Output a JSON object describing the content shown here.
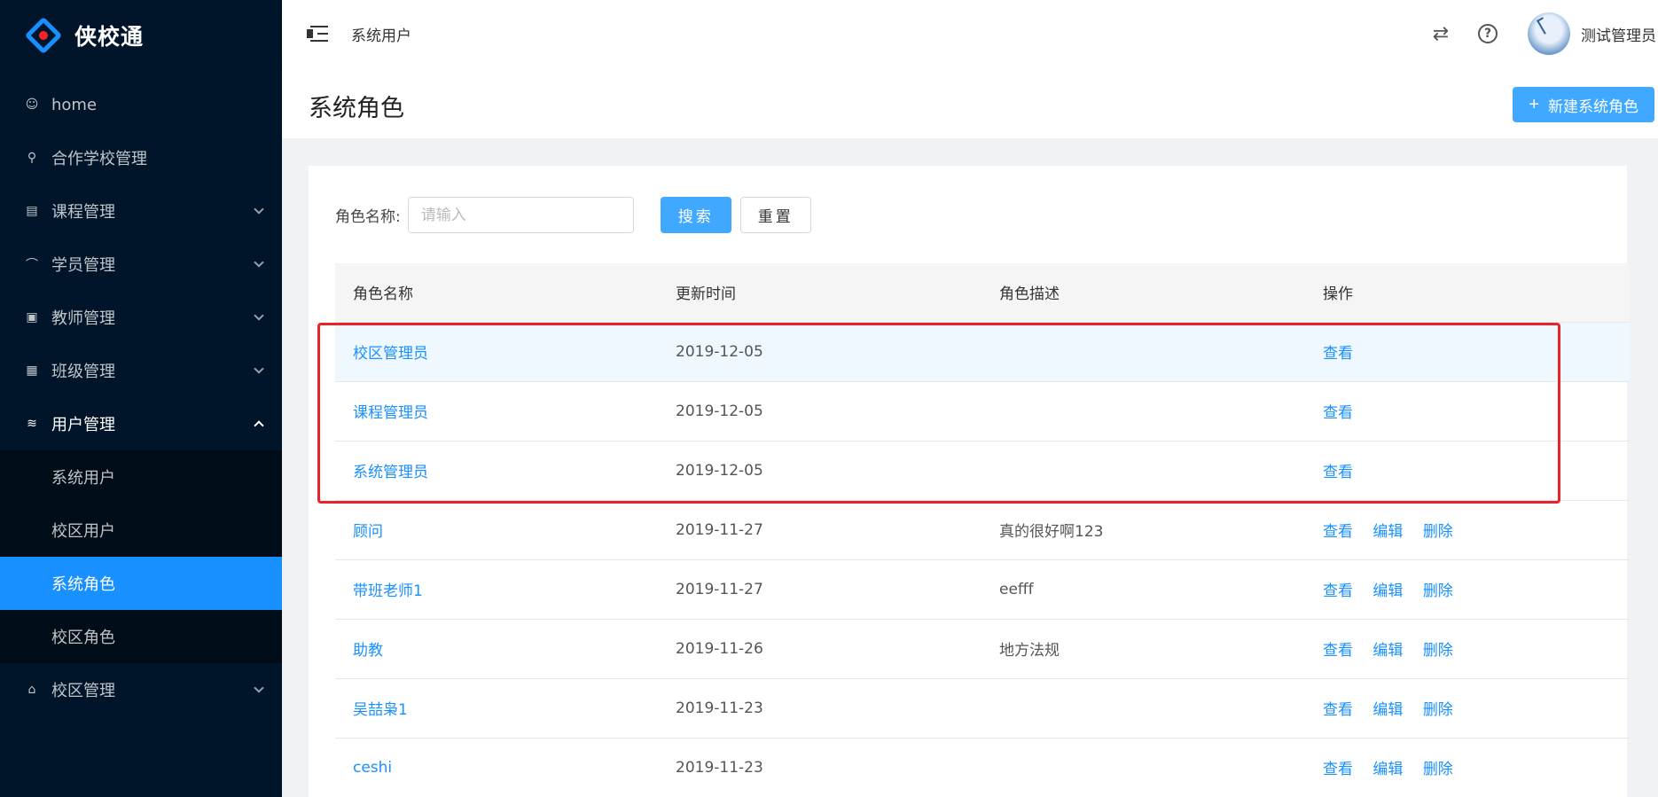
{
  "app": {
    "name": "侠校通"
  },
  "sidebar": {
    "items": [
      {
        "label": "home",
        "icon": "smile-icon"
      },
      {
        "label": "合作学校管理",
        "icon": "bicycle-icon"
      },
      {
        "label": "课程管理",
        "icon": "book-icon"
      },
      {
        "label": "学员管理",
        "icon": "rainbow-icon"
      },
      {
        "label": "教师管理",
        "icon": "idcard-icon"
      },
      {
        "label": "班级管理",
        "icon": "calendar-icon"
      },
      {
        "label": "用户管理",
        "icon": "stack-icon"
      },
      {
        "label": "校区管理",
        "icon": "bank-icon"
      }
    ],
    "submenu": [
      "系统用户",
      "校区用户",
      "系统角色",
      "校区角色"
    ]
  },
  "header": {
    "breadcrumb": "系统用户",
    "username": "测试管理员"
  },
  "page": {
    "title": "系统角色",
    "new_button": "新建系统角色"
  },
  "search": {
    "label": "角色名称:",
    "placeholder": "请输入",
    "search_button": "搜索",
    "reset_button": "重置"
  },
  "table": {
    "columns": [
      "角色名称",
      "更新时间",
      "角色描述",
      "操作"
    ],
    "actions": {
      "view": "查看",
      "edit": "编辑",
      "delete": "删除"
    },
    "rows": [
      {
        "name": "校区管理员",
        "time": "2019-12-05",
        "desc": ""
      },
      {
        "name": "课程管理员",
        "time": "2019-12-05",
        "desc": ""
      },
      {
        "name": "系统管理员",
        "time": "2019-12-05",
        "desc": ""
      },
      {
        "name": "顾问",
        "time": "2019-11-27",
        "desc": "真的很好啊123"
      },
      {
        "name": "带班老师1",
        "time": "2019-11-27",
        "desc": "eefff"
      },
      {
        "name": "助教",
        "time": "2019-11-26",
        "desc": "地方法规"
      },
      {
        "name": "吴喆枭1",
        "time": "2019-11-23",
        "desc": ""
      },
      {
        "name": "ceshi",
        "time": "2019-11-23",
        "desc": ""
      }
    ]
  },
  "colors": {
    "primary": "#1890ff",
    "sidebar_bg": "#001529",
    "highlight_box": "#e8242a"
  }
}
